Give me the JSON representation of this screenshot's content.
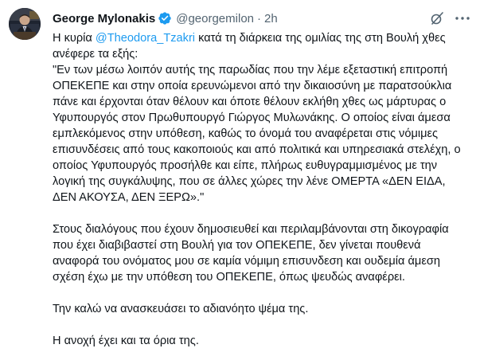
{
  "tweet": {
    "author": {
      "display_name": "George Mylonakis",
      "handle": "@georgemilon",
      "separator": "·",
      "time": "2h",
      "verified_icon": "verified-badge-icon",
      "avatar": "avatar"
    },
    "actions": {
      "grok_icon": "grok-slash-icon",
      "more_icon": "more-options-icon"
    },
    "colors": {
      "text": "#0f1419",
      "secondary": "#536471",
      "accent": "#1d9bf0"
    },
    "text": {
      "intro_before": "Η κυρία ",
      "mention": "@Theodora_Tzakri",
      "intro_after": " κατά τη διάρκεια της ομιλίας της στη Βουλή χθες ανέφερε τα εξής:",
      "quote": "\"Εν των μέσω λοιπόν αυτής της παρωδίας που την λέμε εξεταστική επιτροπή ΟΠΕΚΕΠΕ και στην οποία ερευνώμενοι από την δικαιοσύνη με παρατσούκλια πάνε και έρχονται όταν θέλουν και όποτε θέλουν εκλήθη χθες ως μάρτυρας ο Υφυπουργός στον Πρωθυπουργό Γιώργος Μυλωνάκης. Ο οποίος είναι άμεσα εμπλεκόμενος στην υπόθεση, καθώς το όνομά του αναφέρεται στις νόμιμες επισυνδέσεις από τους κακοποιούς και από πολιτικά και υπηρεσιακά στελέχη, ο οποίος Υφυπουργός προσήλθε και είπε, πλήρως ευθυγραμμισμένος με την λογική της συγκάλυψης, που σε άλλες χώρες την λένε ΟΜΕΡΤΑ «ΔΕΝ ΕΙΔΑ, ΔΕΝ ΑΚΟΥΣΑ, ΔΕΝ ΞΕΡΩ».\"",
      "para2": "Στους διαλόγους που έχουν δημοσιευθεί και περιλαμβάνονται στη δικογραφία που έχει διαβιβαστεί στη Βουλή για τον ΟΠΕΚΕΠΕ, δεν γίνεται πουθενά αναφορά του ονόματος μου σε καμία νόμιμη επισυνδεση και ουδεμία άμεση σχέση έχω με την υπόθεση του ΟΠΕΚΕΠΕ, όπως ψευδώς αναφέρει.",
      "para3": "Την καλώ να ανασκευάσει το αδιανόητο ψέμα της.",
      "para4": "Η ανοχή έχει και τα όρια της."
    }
  }
}
